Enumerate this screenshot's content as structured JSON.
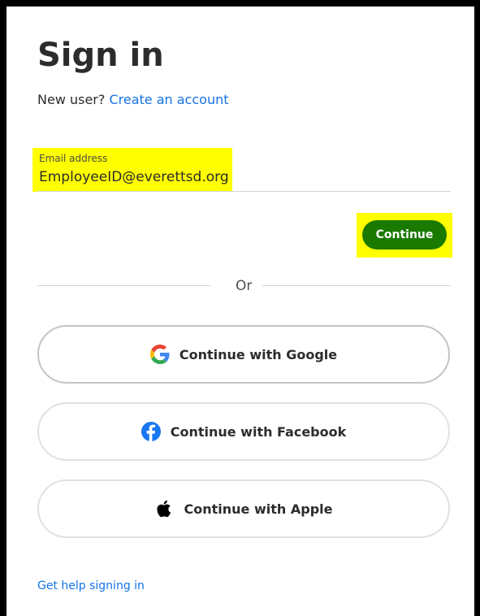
{
  "colors": {
    "frame": "#000000",
    "link": "#1473e6",
    "highlight": "#ffff00",
    "continue_button": "#1a7a00",
    "text": "#2c2c2c"
  },
  "header": {
    "title": "Sign in",
    "new_user_text": "New user?",
    "create_account_label": "Create an account"
  },
  "email": {
    "label": "Email address",
    "value": "EmployeeID@everettsd.org"
  },
  "continue_button": {
    "label": "Continue"
  },
  "divider": {
    "label": "Or"
  },
  "social": [
    {
      "label": "Continue with Google",
      "icon": "google-icon"
    },
    {
      "label": "Continue with Facebook",
      "icon": "facebook-icon"
    },
    {
      "label": "Continue with Apple",
      "icon": "apple-icon"
    }
  ],
  "footer": {
    "help_link": "Get help signing in"
  }
}
